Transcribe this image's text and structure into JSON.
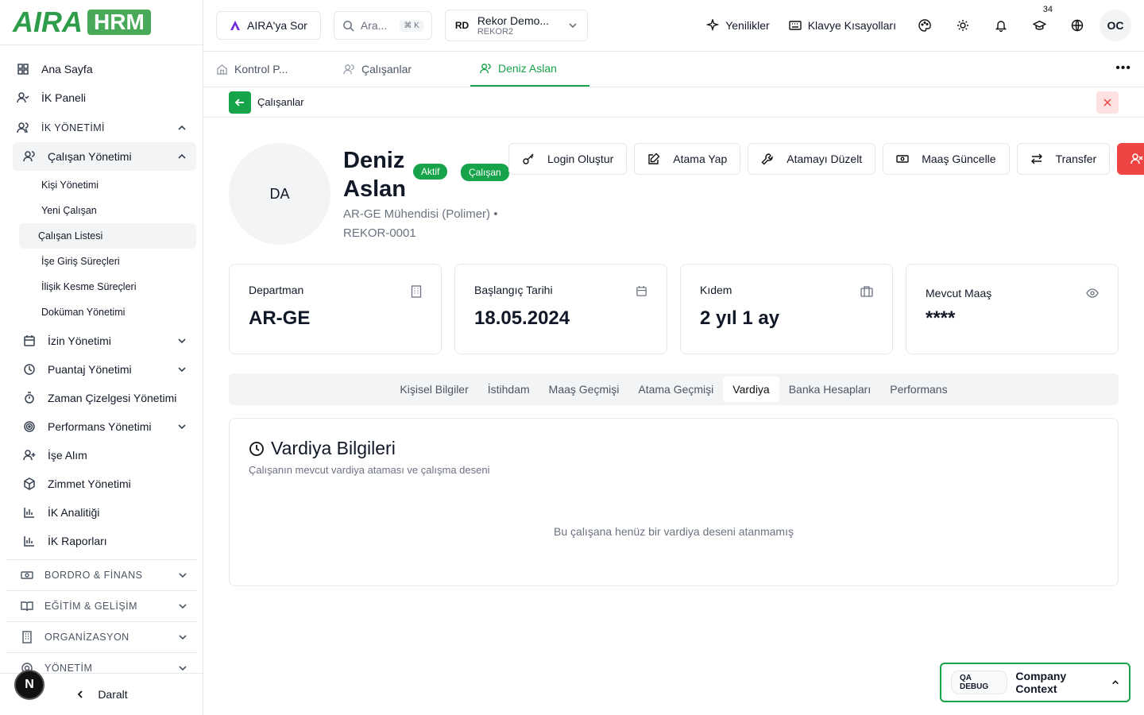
{
  "brand": {
    "logo_text": "AIRA",
    "logo_badge": "HRM"
  },
  "sidebar": {
    "items": [
      {
        "label": "Ana Sayfa"
      },
      {
        "label": "İK Paneli"
      }
    ],
    "section": {
      "label": "İK YÖNETİMİ"
    },
    "group": {
      "label": "Çalışan Yönetimi"
    },
    "sub_items": [
      {
        "label": "Kişi Yönetimi"
      },
      {
        "label": "Yeni Çalışan"
      },
      {
        "label": "Çalışan Listesi"
      },
      {
        "label": "İşe Giriş Süreçleri"
      },
      {
        "label": "İlişik Kesme Süreçleri"
      },
      {
        "label": "Doküman Yönetimi"
      }
    ],
    "modules": [
      {
        "label": "İzin Yönetimi"
      },
      {
        "label": "Puantaj Yönetimi"
      },
      {
        "label": "Zaman Çizelgesi Yönetimi"
      },
      {
        "label": "Performans Yönetimi"
      },
      {
        "label": "İşe Alım"
      },
      {
        "label": "Zimmet Yönetimi"
      },
      {
        "label": "İK Analitiği"
      },
      {
        "label": "İK Raporları"
      }
    ],
    "categories": [
      {
        "label": "BORDRO & FİNANS"
      },
      {
        "label": "EĞİTİM & GELİŞİM"
      },
      {
        "label": "ORGANİZASYON"
      },
      {
        "label": "YÖNETİM"
      }
    ],
    "collapse_label": "Daralt",
    "n_badge": "N"
  },
  "topbar": {
    "ask_label": "AIRA'ya Sor",
    "search_placeholder": "Ara...",
    "search_kbd": "⌘ K",
    "company": {
      "initials": "RD",
      "name": "Rekor Demo...",
      "code": "REKOR2"
    },
    "whats_new": "Yenilikler",
    "shortcuts": "Klavye Kısayolları",
    "notification_count": "34",
    "user_initials": "OC"
  },
  "tabs": [
    {
      "label": "Kontrol P..."
    },
    {
      "label": "Çalışanlar"
    },
    {
      "label": "Deniz Aslan"
    }
  ],
  "breadcrumb": {
    "label": "Çalışanlar"
  },
  "profile": {
    "initials": "DA",
    "first_name": "Deniz",
    "last_name": "Aslan",
    "status": "Aktif",
    "type": "Çalışan",
    "title": "AR-GE Mühendisi (Polimer) •",
    "code": "REKOR-0001"
  },
  "actions": {
    "login": "Login Oluştur",
    "assign": "Atama Yap",
    "edit_assign": "Atamayı Düzelt",
    "salary": "Maaş Güncelle",
    "transfer": "Transfer"
  },
  "cards": [
    {
      "label": "Departman",
      "value": "AR-GE"
    },
    {
      "label": "Başlangıç Tarihi",
      "value": "18.05.2024"
    },
    {
      "label": "Kıdem",
      "value": "2 yıl 1 ay"
    },
    {
      "label": "Mevcut Maaş",
      "value": "****"
    }
  ],
  "subtabs": [
    {
      "label": "Kişisel Bilgiler"
    },
    {
      "label": "İstihdam"
    },
    {
      "label": "Maaş Geçmişi"
    },
    {
      "label": "Atama Geçmişi"
    },
    {
      "label": "Vardiya"
    },
    {
      "label": "Banka Hesapları"
    },
    {
      "label": "Performans"
    }
  ],
  "panel": {
    "title": "Vardiya Bilgileri",
    "description": "Çalışanın mevcut vardiya ataması ve çalışma deseni",
    "empty": "Bu çalışana henüz bir vardiya deseni atanmamış"
  },
  "debug": {
    "tag": "QA DEBUG",
    "label": "Company Context"
  },
  "colors": {
    "accent": "#16a34a",
    "danger": "#ef4444"
  }
}
